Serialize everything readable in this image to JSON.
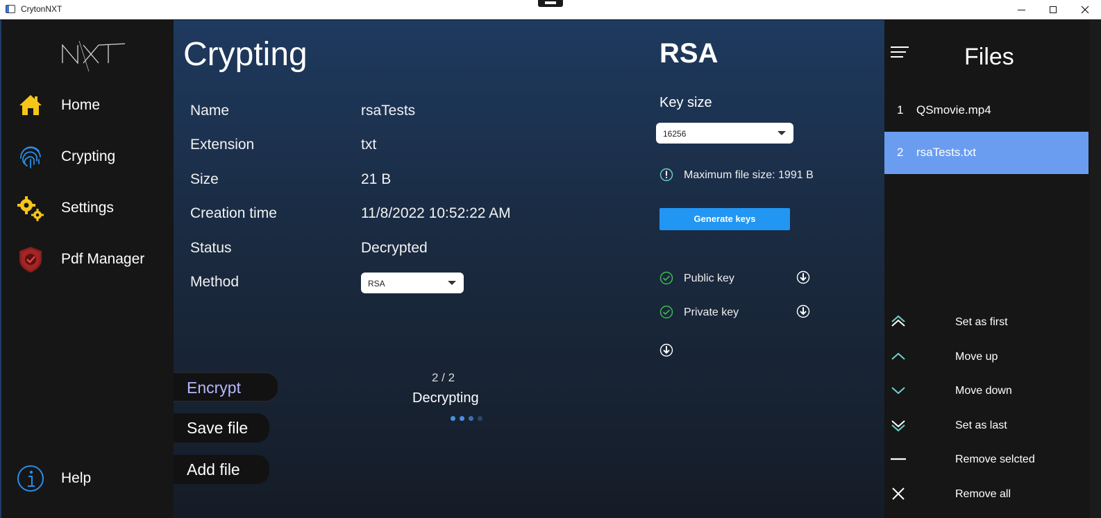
{
  "window": {
    "title": "CrytonNXT"
  },
  "sidebar": {
    "logo_text": "NXT",
    "items": [
      {
        "label": "Home",
        "icon": "home-icon"
      },
      {
        "label": "Crypting",
        "icon": "fingerprint-icon"
      },
      {
        "label": "Settings",
        "icon": "gears-icon"
      },
      {
        "label": "Pdf Manager",
        "icon": "shield-check-icon"
      }
    ],
    "help": {
      "label": "Help",
      "icon": "info-icon"
    }
  },
  "main": {
    "title": "Crypting",
    "properties": [
      {
        "label": "Name",
        "value": "rsaTests"
      },
      {
        "label": "Extension",
        "value": "txt"
      },
      {
        "label": "Size",
        "value": "21 B"
      },
      {
        "label": "Creation time",
        "value": "11/8/2022 10:52:22 AM"
      },
      {
        "label": "Status",
        "value": "Decrypted"
      },
      {
        "label": "Method",
        "value": "RSA"
      }
    ],
    "actions": {
      "encrypt": "Encrypt",
      "save": "Save file",
      "add": "Add file"
    },
    "progress": {
      "count": "2 / 2",
      "label": "Decrypting",
      "dots_total": 4,
      "dots_active": 2
    },
    "rsa": {
      "title": "RSA",
      "key_size_label": "Key size",
      "key_size_value": "16256",
      "max_file_size": "Maximum file size: 1991 B",
      "generate_label": "Generate keys",
      "public_key_label": "Public key",
      "private_key_label": "Private key"
    }
  },
  "files": {
    "title": "Files",
    "items": [
      {
        "num": "1",
        "name": "QSmovie.mp4",
        "selected": false
      },
      {
        "num": "2",
        "name": "rsaTests.txt",
        "selected": true
      }
    ],
    "commands": [
      {
        "label": "Set as first",
        "icon": "double-chevron-up-icon"
      },
      {
        "label": "Move up",
        "icon": "chevron-up-icon"
      },
      {
        "label": "Move down",
        "icon": "chevron-down-icon"
      },
      {
        "label": "Set as last",
        "icon": "double-chevron-down-icon"
      },
      {
        "label": "Remove selcted",
        "icon": "minus-icon"
      },
      {
        "label": "Remove all",
        "icon": "close-icon"
      }
    ]
  },
  "colors": {
    "accent_blue": "#2196f3",
    "selected_file": "#6a9df0",
    "encrypt_text": "#b4b8ff",
    "check_green": "#3fb950",
    "icon_teal": "#6fd3c8"
  }
}
